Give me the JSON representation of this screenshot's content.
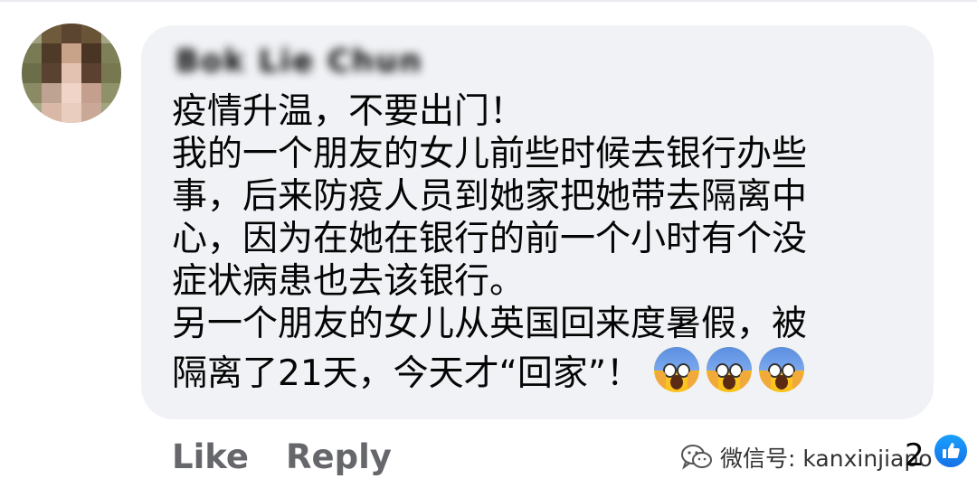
{
  "comment": {
    "author_name": "Bok Lie Chun",
    "lines": [
      "疫情升温，不要出门！",
      "我的一个朋友的女儿前些时候去银行办些",
      "事，后来防疫人员到她家把她带去隔离中",
      "心，因为在她在银行的前一个小时有个没",
      "症状病患也去该银行。",
      "另一个朋友的女儿从英国回来度暑假，被",
      "隔离了21天，今天才“回家”！"
    ],
    "emojis": [
      "face-screaming-in-fear",
      "face-screaming-in-fear",
      "face-screaming-in-fear"
    ]
  },
  "actions": {
    "like_label": "Like",
    "reply_label": "Reply"
  },
  "reactions": {
    "count": "2",
    "icon": "like-thumb-icon",
    "color": "#1877f2"
  },
  "watermark": {
    "text": "微信号: kanxinjiapo",
    "icon": "wechat-icon"
  },
  "colors": {
    "bubble": "#f0f2f5",
    "action_text": "#65676b",
    "body_text": "#050505"
  }
}
